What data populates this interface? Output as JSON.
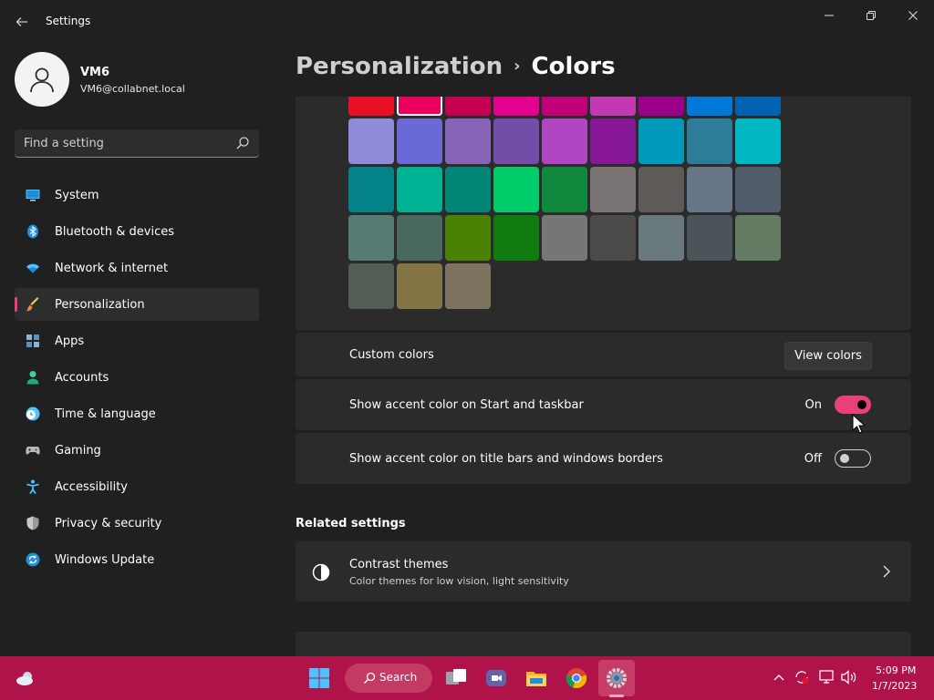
{
  "window": {
    "title": "Settings"
  },
  "profile": {
    "name": "VM6",
    "email": "VM6@collabnet.local"
  },
  "search": {
    "placeholder": "Find a setting"
  },
  "nav": [
    {
      "label": "System",
      "icon": "monitor-icon"
    },
    {
      "label": "Bluetooth & devices",
      "icon": "bluetooth-icon"
    },
    {
      "label": "Network & internet",
      "icon": "wifi-icon"
    },
    {
      "label": "Personalization",
      "icon": "brush-icon",
      "active": true
    },
    {
      "label": "Apps",
      "icon": "apps-icon"
    },
    {
      "label": "Accounts",
      "icon": "person-icon"
    },
    {
      "label": "Time & language",
      "icon": "clock-globe-icon"
    },
    {
      "label": "Gaming",
      "icon": "gamepad-icon"
    },
    {
      "label": "Accessibility",
      "icon": "accessibility-icon"
    },
    {
      "label": "Privacy & security",
      "icon": "shield-icon"
    },
    {
      "label": "Windows Update",
      "icon": "update-icon"
    }
  ],
  "breadcrumb": {
    "parent": "Personalization",
    "separator": "›",
    "current": "Colors"
  },
  "swatches": [
    "#e81123",
    "#ea005e",
    "#c30052",
    "#e3008c",
    "#bf0077",
    "#c239b3",
    "#9a0089",
    "#0078d7",
    "#0063b1",
    "#8e8cd8",
    "#6b69d6",
    "#8764b8",
    "#744da9",
    "#b146c2",
    "#881798",
    "#0099bc",
    "#2d7d9a",
    "#00b7c3",
    "#038387",
    "#00b294",
    "#018574",
    "#00cc6a",
    "#10893e",
    "#7a7574",
    "#5d5a58",
    "#68768a",
    "#515c6b",
    "#567c73",
    "#486860",
    "#498205",
    "#107c10",
    "#767676",
    "#4c4a48",
    "#69797e",
    "#4a5459",
    "#647c64",
    "#525e54",
    "#847545",
    "#7e735f"
  ],
  "selected_swatch": "#ea005e",
  "custom_colors": {
    "label": "Custom colors",
    "button": "View colors"
  },
  "accent_start": {
    "label": "Show accent color on Start and taskbar",
    "state": "On",
    "enabled": true
  },
  "accent_titlebar": {
    "label": "Show accent color on title bars and windows borders",
    "state": "Off",
    "enabled": false
  },
  "related": {
    "heading": "Related settings",
    "contrast_title": "Contrast themes",
    "contrast_subtitle": "Color themes for low vision, light sensitivity"
  },
  "taskbar": {
    "search_label": "Search",
    "time": "5:09 PM",
    "date": "1/7/2023"
  },
  "colors": {
    "accent": "#e9407a",
    "taskbar": "#b0134a",
    "background": "#202020",
    "card": "#2b2b2b"
  }
}
